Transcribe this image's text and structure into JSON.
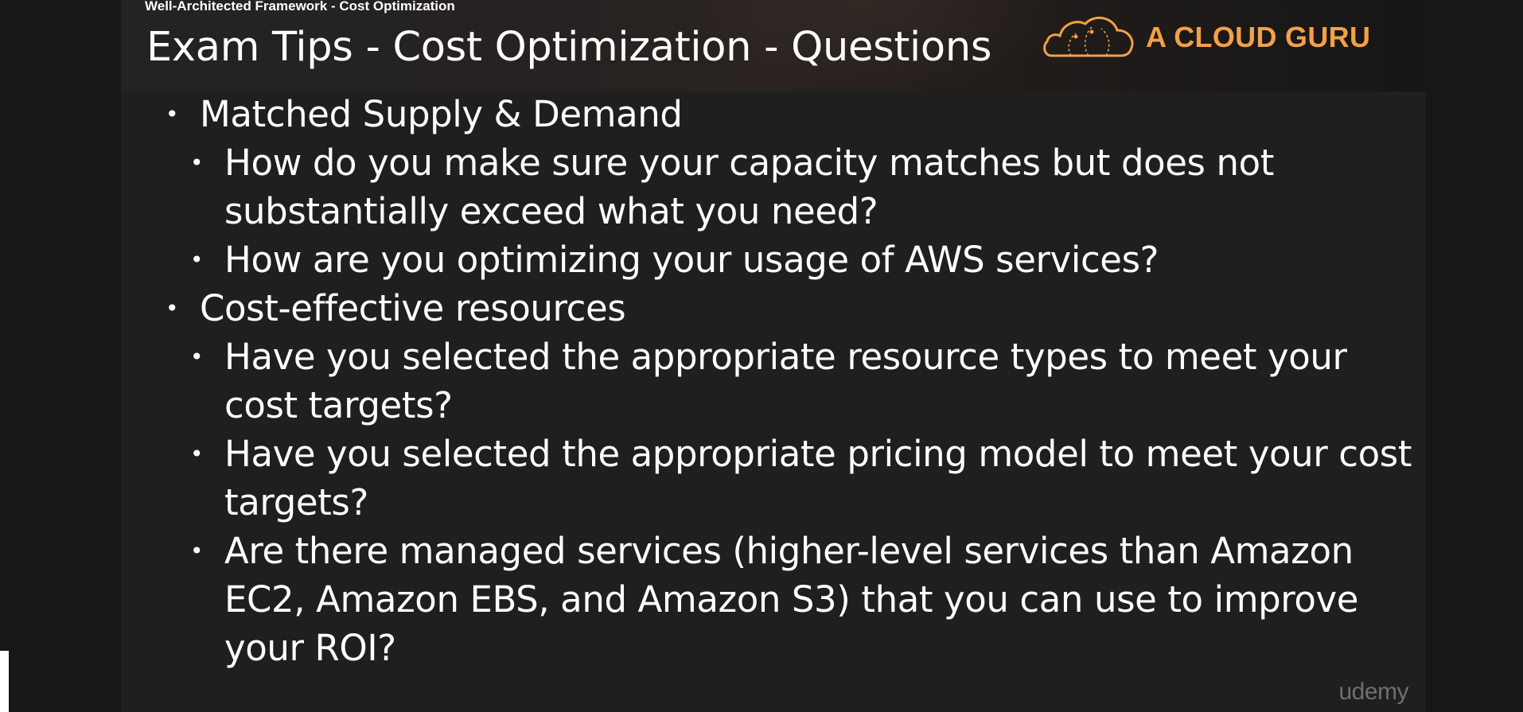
{
  "slide": {
    "section_label": "Well-Architected Framework - Cost Optimization",
    "title": "Exam Tips - Cost Optimization - Questions",
    "brand": {
      "name": "A CLOUD GURU",
      "logo_icon": "cloud-logo-icon",
      "accent_color": "#f3a046"
    },
    "bullets": [
      {
        "level": 1,
        "text": "Matched Supply & Demand"
      },
      {
        "level": 2,
        "text": "How do you make sure your capacity matches but does not substantially exceed what you need?"
      },
      {
        "level": 2,
        "text": "How are you optimizing your usage of AWS services?"
      },
      {
        "level": 1,
        "text": "Cost-effective resources"
      },
      {
        "level": 2,
        "text": "Have you selected the appropriate resource types to meet your cost targets?"
      },
      {
        "level": 2,
        "text": "Have you selected the appropriate pricing model to meet your cost targets?"
      },
      {
        "level": 2,
        "text": "Are there managed services (higher-level services than Amazon EC2, Amazon EBS, and Amazon S3) that you can use to improve your ROI?"
      }
    ],
    "bullet_glyph": "•",
    "watermark": "udemy"
  },
  "colors": {
    "background": "#171717",
    "slide_background": "#1f1f1f",
    "text": "#ffffff"
  }
}
